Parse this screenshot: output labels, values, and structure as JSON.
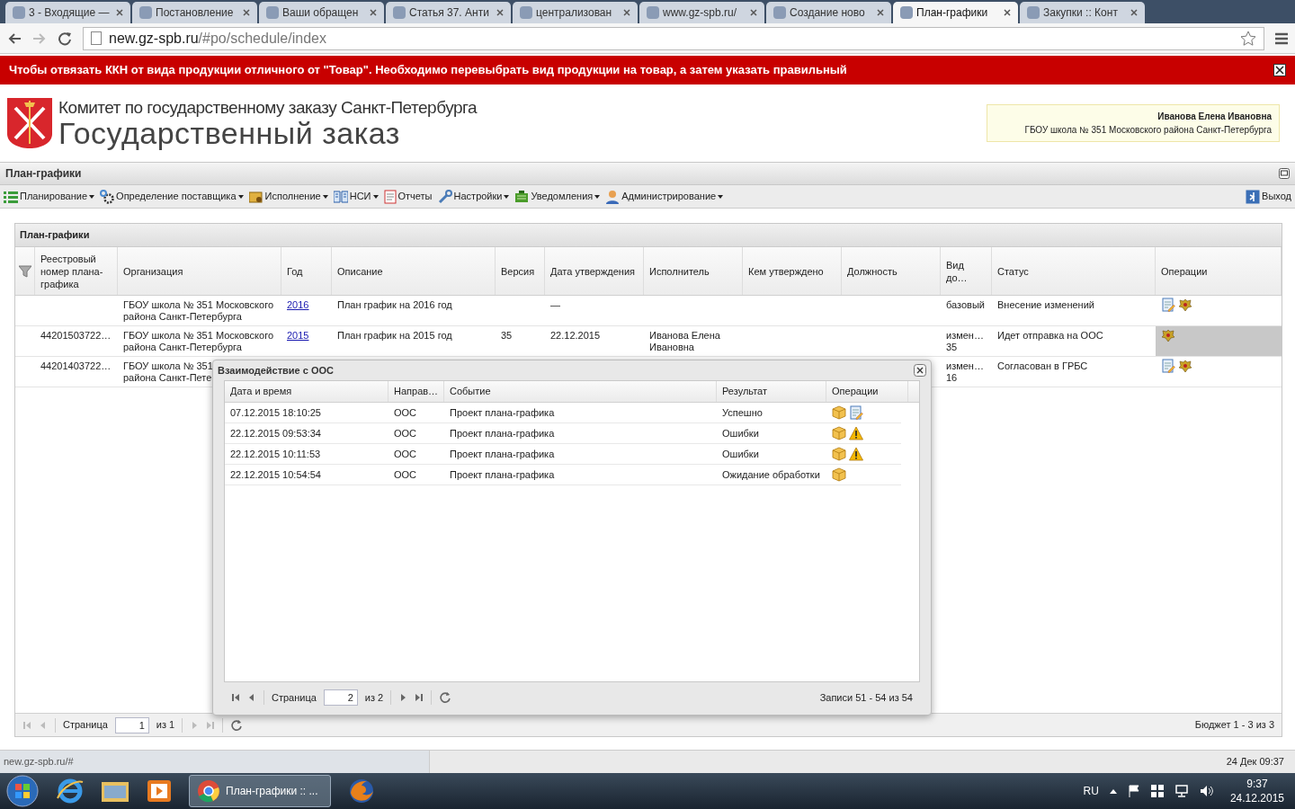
{
  "browser": {
    "tabs": [
      {
        "title": "3 - Входящие —",
        "selected": false
      },
      {
        "title": "Постановление",
        "selected": false
      },
      {
        "title": "Ваши обращен",
        "selected": false
      },
      {
        "title": "Статья 37. Анти",
        "selected": false
      },
      {
        "title": "централизован",
        "selected": false
      },
      {
        "title": "www.gz-spb.ru/",
        "selected": false
      },
      {
        "title": "Создание ново",
        "selected": false
      },
      {
        "title": "План-графики",
        "selected": true
      },
      {
        "title": "Закупки :: Конт",
        "selected": false
      }
    ],
    "address": {
      "host": "new.gz-spb.ru",
      "path": "/#po/schedule/index"
    }
  },
  "alert": "Чтобы отвязать ККН от вида продукции отличного от \"Товар\". Необходимо перевыбрать вид продукции на товар, а затем указать правильный",
  "header": {
    "committee": "Комитет по государственному заказу Санкт-Петербурга",
    "title": "Государственный заказ",
    "user_name": "Иванова Елена Ивановна",
    "user_org": "ГБОУ школа № 351 Московского района Санкт-Петербурга"
  },
  "section_title": "План-графики",
  "menu": [
    {
      "label": "Планирование",
      "has_menu": true
    },
    {
      "label": "Определение поставщика",
      "has_menu": true
    },
    {
      "label": "Исполнение",
      "has_menu": true
    },
    {
      "label": "НСИ",
      "has_menu": true
    },
    {
      "label": "Отчеты",
      "has_menu": false
    },
    {
      "label": "Настройки",
      "has_menu": true
    },
    {
      "label": "Уведомления",
      "has_menu": true
    },
    {
      "label": "Администрирование",
      "has_menu": true
    }
  ],
  "logout": "Выход",
  "grid": {
    "title": "План-графики",
    "columns": [
      "Реестровый номер плана-графика",
      "Организация",
      "Год",
      "Описание",
      "Версия",
      "Дата утверждения",
      "Исполнитель",
      "Кем утверждено",
      "Должность",
      "Вид до…",
      "Статус",
      "Операции"
    ],
    "rows": [
      {
        "reg": "",
        "org": [
          "ГБОУ школа № 351 Московского",
          "района Санкт-Петербурга"
        ],
        "year": "2016",
        "desc": "План график на 2016 год",
        "date": "—",
        "doc_kind": "базовый",
        "status": "Внесение изменений",
        "ops": [
          {
            "kind": "edit"
          },
          {
            "kind": "emblem"
          }
        ],
        "selected": false
      },
      {
        "reg": "44201503722…",
        "org": [
          "ГБОУ школа № 351 Московского",
          "района Санкт-Петербурга"
        ],
        "year": "2015",
        "desc": "План график на 2015 год",
        "version": "35",
        "date": "22.12.2015",
        "executor": "Иванова Елена Ивановна",
        "doc_kind": "измен… 35",
        "status": "Идет отправка на ООС",
        "ops": [
          {
            "kind": "emblem"
          }
        ],
        "selected": true
      },
      {
        "reg": "44201403722…",
        "org": [
          "ГБОУ школа № 351",
          "района Санкт-Пете"
        ],
        "doc_kind": "измен… 16",
        "status": "Согласован в ГРБС",
        "ops": [
          {
            "kind": "edit"
          },
          {
            "kind": "emblem"
          }
        ],
        "selected": false
      }
    ],
    "pager": {
      "label": "Страница",
      "page": "1",
      "of": "из 1",
      "summary": "Бюджет 1 - 3 из 3"
    }
  },
  "dialog": {
    "title": "Взаимодействие с ООС",
    "columns": [
      "Дата и время",
      "Направ…",
      "Событие",
      "Результат",
      "Операции"
    ],
    "rows": [
      {
        "time": "07.12.2015 18:10:25",
        "direction": "ООС",
        "event": "Проект плана-графика",
        "result": "Успешно",
        "ops": [
          {
            "kind": "package"
          },
          {
            "kind": "edit"
          }
        ]
      },
      {
        "time": "22.12.2015 09:53:34",
        "direction": "ООС",
        "event": "Проект плана-графика",
        "result": "Ошибки",
        "ops": [
          {
            "kind": "package"
          },
          {
            "kind": "warning"
          }
        ]
      },
      {
        "time": "22.12.2015 10:11:53",
        "direction": "ООС",
        "event": "Проект плана-графика",
        "result": "Ошибки",
        "ops": [
          {
            "kind": "package"
          },
          {
            "kind": "warning"
          }
        ]
      },
      {
        "time": "22.12.2015 10:54:54",
        "direction": "ООС",
        "event": "Проект плана-графика",
        "result": "Ожидание обработки",
        "ops": [
          {
            "kind": "package"
          }
        ]
      }
    ],
    "pager": {
      "label": "Страница",
      "page": "2",
      "of": "из 2",
      "summary": "Записи 51 - 54 из 54"
    }
  },
  "status_bar": {
    "url": "new.gz-spb.ru/#",
    "datetime": "24 Дек 09:37"
  },
  "taskbar": {
    "app_title": "План-графики :: ...",
    "language": "RU",
    "time": "9:37",
    "date": "24.12.2015"
  }
}
